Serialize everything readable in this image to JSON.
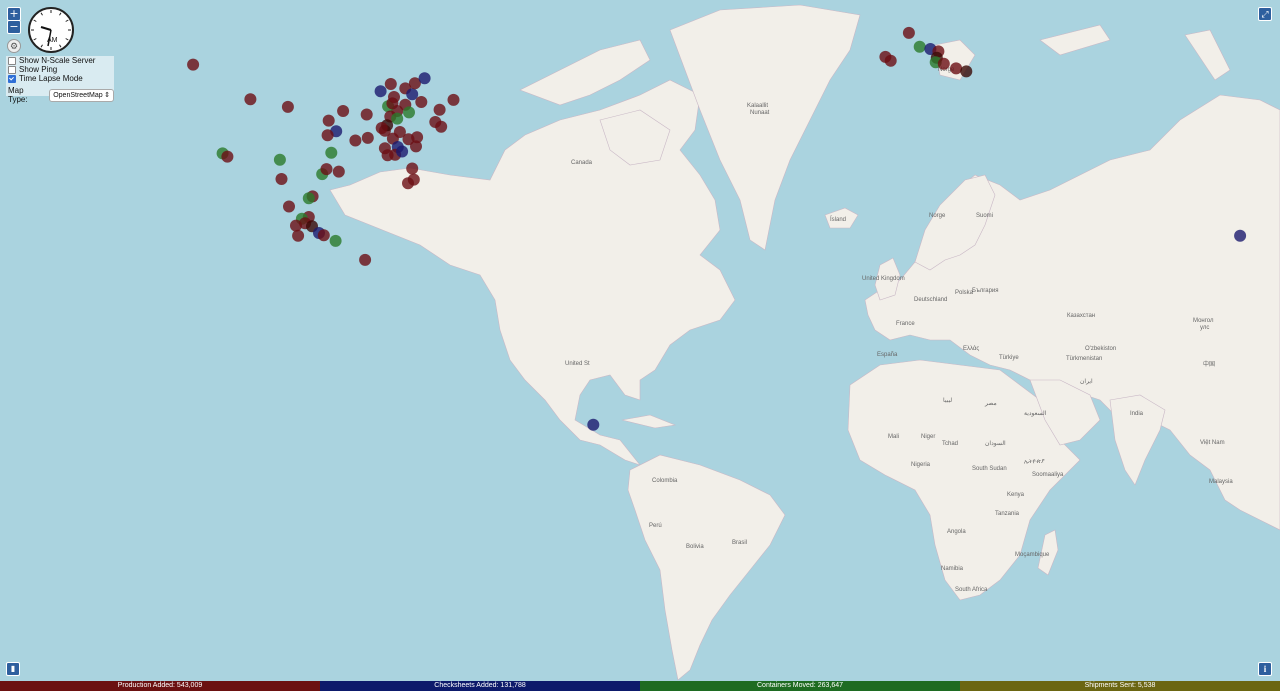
{
  "controls": {
    "zoom_in": "+",
    "zoom_out": "−",
    "show_nscale_label": "Show N-Scale Server",
    "show_ping_label": "Show Ping",
    "time_lapse_label": "Time Lapse Mode",
    "show_nscale_checked": false,
    "show_ping_checked": false,
    "time_lapse_checked": true,
    "map_type_label": "Map Type:",
    "map_type_value": "OpenStreetMap"
  },
  "clock": {
    "period": "AM"
  },
  "map_labels": {
    "greenland": "Kalaallit",
    "greenland2": "Nunaat",
    "canada": "Canada",
    "usa": "United St",
    "brasil": "Brasil",
    "colombia": "Colombia",
    "peru": "Perú",
    "bolivia": "Bolivia",
    "island": "Ísland",
    "norge": "Norge",
    "norge2": "Norge",
    "suomi": "Suomi",
    "uk": "United Kingdom",
    "france": "France",
    "espana": "España",
    "mali": "Mali",
    "niger": "Niger",
    "tchad": "Tchad",
    "nigeria": "Nigeria",
    "south_sudan": "South Sudan",
    "kenya": "Kenya",
    "tanzania": "Tanzania",
    "angola": "Angola",
    "namibia": "Namibia",
    "south_africa": "South Africa",
    "mocambique": "Moçambique",
    "turkiye": "Türkiye",
    "kazakhstan": "Казахстан",
    "mongolia": "Монгол",
    "mongolia2": "улс",
    "uzbekistan": "O'zbekiston",
    "turkmenistan": "Türkmenistan",
    "zhongguo": "中国",
    "vietnam": "Việt Nam",
    "malaysia": "Malaysia",
    "ellas": "Ελλάς",
    "balgariya": "България",
    "somaliya": "Soomaaliya",
    "misr": "مصر",
    "sudan": "السودان",
    "libya": "ليبيا",
    "saudi": "السعودية",
    "iran": "ایران",
    "india": "India",
    "ethiopia": "ኢትዮጵያ",
    "deutschland": "Deutschland",
    "polska": "Polska"
  },
  "colors": {
    "production": "#6b1111",
    "checksheets": "#0d1a6b",
    "containers": "#1e6b22",
    "shipments": "#6b6612",
    "marker_production": "#6b0f14",
    "marker_checksheets": "#1c1a6e",
    "marker_containers": "#2b7a2b",
    "marker_dark": "#3a0a06"
  },
  "markers": [
    {
      "lat": 45.5,
      "lon": -122.6,
      "kind": "production"
    },
    {
      "lat": 40.8,
      "lon": -111.9,
      "kind": "production"
    },
    {
      "lat": 32.7,
      "lon": -117.1,
      "kind": "containers"
    },
    {
      "lat": 32.2,
      "lon": -116.2,
      "kind": "production"
    },
    {
      "lat": 31.7,
      "lon": -106.4,
      "kind": "containers"
    },
    {
      "lat": 28.6,
      "lon": -106.1,
      "kind": "production"
    },
    {
      "lat": 29.4,
      "lon": -98.5,
      "kind": "containers"
    },
    {
      "lat": 29.8,
      "lon": -95.4,
      "kind": "production"
    },
    {
      "lat": 32.8,
      "lon": -96.8,
      "kind": "containers"
    },
    {
      "lat": 30.2,
      "lon": -97.7,
      "kind": "production"
    },
    {
      "lat": 25.7,
      "lon": -100.3,
      "kind": "production"
    },
    {
      "lat": 25.4,
      "lon": -101.0,
      "kind": "containers"
    },
    {
      "lat": 24.0,
      "lon": -104.7,
      "kind": "production"
    },
    {
      "lat": 22.2,
      "lon": -101.0,
      "kind": "production"
    },
    {
      "lat": 21.9,
      "lon": -102.3,
      "kind": "containers"
    },
    {
      "lat": 21.1,
      "lon": -101.7,
      "kind": "production"
    },
    {
      "lat": 20.7,
      "lon": -103.4,
      "kind": "production"
    },
    {
      "lat": 20.6,
      "lon": -100.4,
      "kind": "marker_dark"
    },
    {
      "lat": 19.4,
      "lon": -99.1,
      "kind": "checksheets"
    },
    {
      "lat": 19.0,
      "lon": -98.2,
      "kind": "production"
    },
    {
      "lat": 18.0,
      "lon": -96.0,
      "kind": "containers"
    },
    {
      "lat": 18.9,
      "lon": -103.0,
      "kind": "production"
    },
    {
      "lat": 14.6,
      "lon": -90.5,
      "kind": "production"
    },
    {
      "lat": 38.6,
      "lon": -90.2,
      "kind": "production"
    },
    {
      "lat": 39.1,
      "lon": -94.6,
      "kind": "production"
    },
    {
      "lat": 41.9,
      "lon": -87.6,
      "kind": "checksheets"
    },
    {
      "lat": 42.3,
      "lon": -83.0,
      "kind": "production"
    },
    {
      "lat": 41.5,
      "lon": -81.7,
      "kind": "checksheets"
    },
    {
      "lat": 40.0,
      "lon": -83.0,
      "kind": "production"
    },
    {
      "lat": 39.1,
      "lon": -84.5,
      "kind": "production"
    },
    {
      "lat": 39.8,
      "lon": -86.2,
      "kind": "containers"
    },
    {
      "lat": 38.3,
      "lon": -85.8,
      "kind": "production"
    },
    {
      "lat": 36.2,
      "lon": -86.8,
      "kind": "production"
    },
    {
      "lat": 35.1,
      "lon": -90.0,
      "kind": "production"
    },
    {
      "lat": 33.5,
      "lon": -86.8,
      "kind": "production"
    },
    {
      "lat": 35.0,
      "lon": -85.3,
      "kind": "production"
    },
    {
      "lat": 36.0,
      "lon": -84.0,
      "kind": "production"
    },
    {
      "lat": 34.9,
      "lon": -82.4,
      "kind": "production"
    },
    {
      "lat": 35.2,
      "lon": -80.8,
      "kind": "production"
    },
    {
      "lat": 33.7,
      "lon": -84.4,
      "kind": "checksheets"
    },
    {
      "lat": 32.4,
      "lon": -86.3,
      "kind": "production"
    },
    {
      "lat": 40.4,
      "lon": -80.0,
      "kind": "production"
    },
    {
      "lat": 41.1,
      "lon": -85.1,
      "kind": "production"
    },
    {
      "lat": 42.9,
      "lon": -85.7,
      "kind": "production"
    },
    {
      "lat": 43.0,
      "lon": -81.2,
      "kind": "production"
    },
    {
      "lat": 43.7,
      "lon": -79.4,
      "kind": "checksheets"
    },
    {
      "lat": 37.5,
      "lon": -77.4,
      "kind": "production"
    },
    {
      "lat": 39.3,
      "lon": -76.6,
      "kind": "production"
    },
    {
      "lat": 40.7,
      "lon": -74.0,
      "kind": "production"
    },
    {
      "lat": 36.8,
      "lon": -76.3,
      "kind": "production"
    },
    {
      "lat": 38.0,
      "lon": -84.5,
      "kind": "containers"
    },
    {
      "lat": 37.0,
      "lon": -86.4,
      "kind": "marker_dark"
    },
    {
      "lat": 34.7,
      "lon": -92.3,
      "kind": "production"
    },
    {
      "lat": 36.1,
      "lon": -95.9,
      "kind": "checksheets"
    },
    {
      "lat": 37.7,
      "lon": -97.3,
      "kind": "production"
    },
    {
      "lat": 39.7,
      "lon": -104.9,
      "kind": "production"
    },
    {
      "lat": 35.5,
      "lon": -97.5,
      "kind": "production"
    },
    {
      "lat": 32.5,
      "lon": -84.9,
      "kind": "production"
    },
    {
      "lat": 33.0,
      "lon": -83.6,
      "kind": "checksheets"
    },
    {
      "lat": 33.8,
      "lon": -81.0,
      "kind": "production"
    },
    {
      "lat": 36.6,
      "lon": -87.4,
      "kind": "production"
    },
    {
      "lat": 40.2,
      "lon": -85.4,
      "kind": "production"
    },
    {
      "lat": 38.9,
      "lon": -82.3,
      "kind": "containers"
    },
    {
      "lat": 30.3,
      "lon": -81.7,
      "kind": "production"
    },
    {
      "lat": 28.5,
      "lon": -81.4,
      "kind": "production"
    },
    {
      "lat": 27.9,
      "lon": -82.5,
      "kind": "production"
    },
    {
      "lat": -15.8,
      "lon": -47.9,
      "kind": "checksheets"
    },
    {
      "lat": 49.5,
      "lon": 11.0,
      "kind": "production"
    },
    {
      "lat": 46.5,
      "lon": 6.6,
      "kind": "production"
    },
    {
      "lat": 46.0,
      "lon": 7.6,
      "kind": "production"
    },
    {
      "lat": 47.8,
      "lon": 13.0,
      "kind": "containers"
    },
    {
      "lat": 47.5,
      "lon": 15.0,
      "kind": "checksheets"
    },
    {
      "lat": 47.2,
      "lon": 16.5,
      "kind": "production"
    },
    {
      "lat": 46.4,
      "lon": 16.2,
      "kind": "marker_dark"
    },
    {
      "lat": 45.8,
      "lon": 16.0,
      "kind": "containers"
    },
    {
      "lat": 45.6,
      "lon": 17.5,
      "kind": "production"
    },
    {
      "lat": 45.0,
      "lon": 19.8,
      "kind": "production"
    },
    {
      "lat": 44.6,
      "lon": 21.7,
      "kind": "marker_dark"
    },
    {
      "lat": 18.9,
      "lon": 72.8,
      "kind": "checksheets"
    },
    {
      "lat": 22.6,
      "lon": 88.4,
      "kind": "marker_dark"
    }
  ],
  "status": {
    "production": "Production Added: 543,009",
    "checksheets": "Checksheets Added: 131,788",
    "containers": "Containers Moved: 263,647",
    "shipments": "Shipments Sent: 5,538"
  }
}
